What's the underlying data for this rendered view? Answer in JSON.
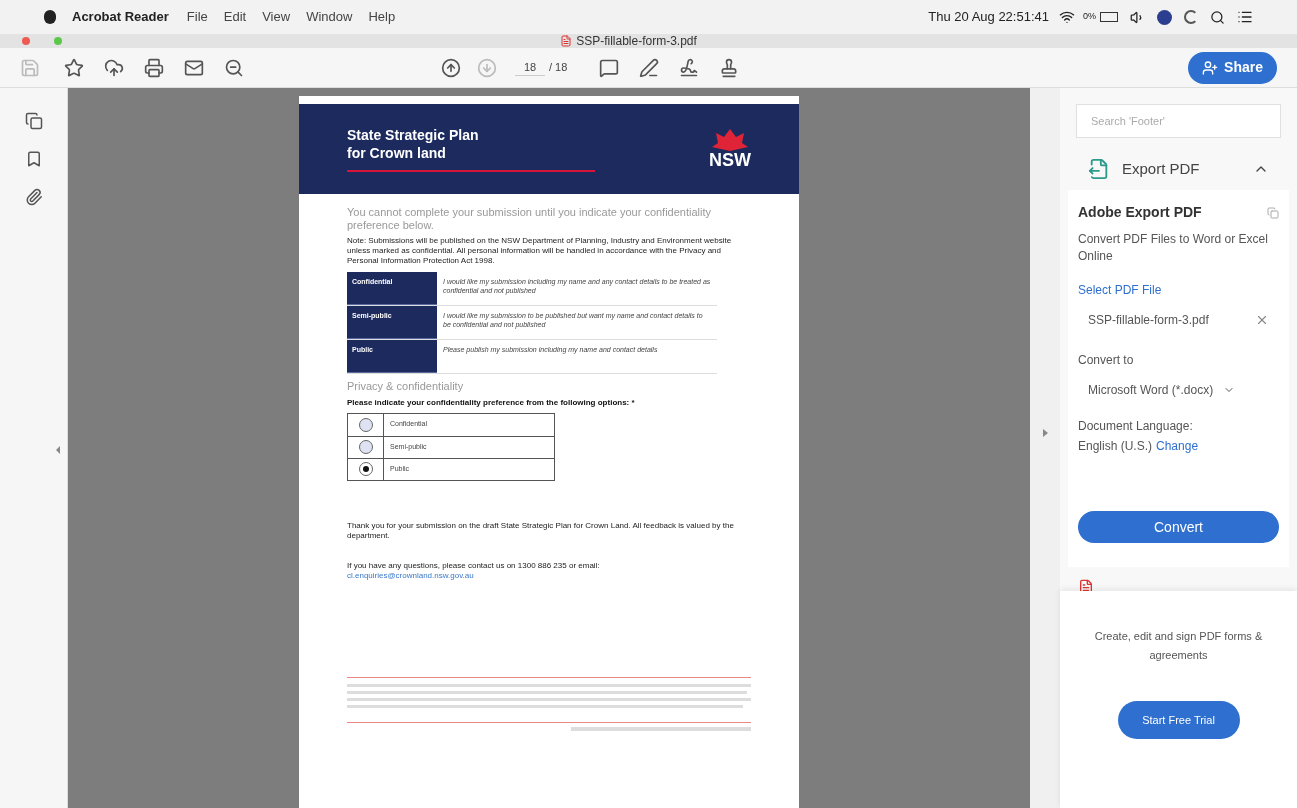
{
  "menu_bar": {
    "app": "Acrobat Reader",
    "items": [
      "File",
      "Edit",
      "View",
      "Window",
      "Help"
    ],
    "clock": "Thu 20 Aug  22:51:41",
    "battery": "0%"
  },
  "window": {
    "title": "SSP-fillable-form-3.pdf"
  },
  "toolbar": {
    "page_current": "18",
    "page_total": "/ 18",
    "share": "Share"
  },
  "document": {
    "header_title": "State Strategic Plan\nfor Crown land",
    "logo": "NSW",
    "intro": "You cannot complete your submission until you indicate your confidentiality preference below.",
    "note": "Note:  Submissions will be published on the NSW Department of Planning, Industry and Environment website unless marked as confidential. All personal information will be handled in accordance with the Privacy and Personal Information Protection Act 1998.",
    "options_table": [
      {
        "label": "Confidential",
        "description": "I would like my submission including my name and any contact details to be treated as confidential and not published"
      },
      {
        "label": "Semi-public",
        "description": "I would like my submission to be published but want my name and contact details to be confidential and not published"
      },
      {
        "label": "Public",
        "description": "Please publish my submission including my name and contact details"
      }
    ],
    "section_title": "Privacy & confidentiality",
    "question": "Please indicate your confidentiality preference from the following options: *",
    "choices": [
      {
        "label": "Confidential",
        "selected": false
      },
      {
        "label": "Semi-public",
        "selected": false
      },
      {
        "label": "Public",
        "selected": true
      }
    ],
    "thanks": "Thank you for your submission on the draft State Strategic Plan for Crown Land. All feedback is valued by the department.",
    "contact": "If you have any questions, please contact us on 1300 886 235 or email:",
    "email": "cl.enquiries@crownland.nsw.gov.au"
  },
  "panel": {
    "search_placeholder": "Search 'Footer'",
    "tool": {
      "label": "Export PDF",
      "expanded": true
    },
    "heading": "Adobe Export PDF",
    "description": "Convert PDF Files to Word or Excel Online",
    "select_link": "Select PDF File",
    "file_name": "SSP-fillable-form-3.pdf",
    "convert_to_label": "Convert to",
    "format": "Microsoft Word (*.docx)",
    "language_label": "Document Language:",
    "language": "English (U.S.)",
    "change_link": "Change",
    "convert_button": "Convert",
    "promo": "Create, edit and sign PDF forms & agreements",
    "trial_button": "Start Free Trial"
  }
}
